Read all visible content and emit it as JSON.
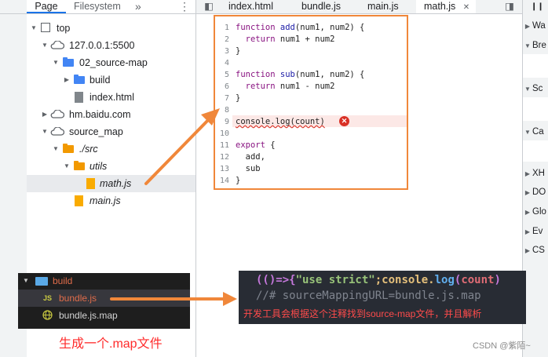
{
  "left_panel": {
    "tabs": [
      "Page",
      "Filesystem"
    ],
    "more_label": "»",
    "kebab_label": "⋮",
    "tree": [
      {
        "label": "top"
      },
      {
        "label": "127.0.0.1:5500"
      },
      {
        "label": "02_source-map"
      },
      {
        "label": "build"
      },
      {
        "label": "index.html"
      },
      {
        "label": "hm.baidu.com"
      },
      {
        "label": "source_map"
      },
      {
        "label": "./src"
      },
      {
        "label": "utils"
      },
      {
        "label": "math.js"
      },
      {
        "label": "main.js"
      }
    ]
  },
  "editor": {
    "tabs": [
      "index.html",
      "bundle.js",
      "main.js",
      "math.js"
    ],
    "close_label": "✕",
    "line_numbers": [
      "1",
      "2",
      "3",
      "4",
      "5",
      "6",
      "7",
      "8",
      "9",
      "10",
      "11",
      "12",
      "13",
      "14"
    ],
    "code": {
      "l1a": "function",
      "l1b": " add",
      "l1c": "(num1, num2) {",
      "l2a": "  return",
      "l2b": " num1 + num2",
      "l3": "}",
      "l5a": "function",
      "l5b": " sub",
      "l5c": "(num1, num2) {",
      "l6a": "  return",
      "l6b": " num1 - num2",
      "l7": "}",
      "l9": "console.log(count)",
      "l11a": "export",
      "l11b": " {",
      "l12": "  add,",
      "l13": "  sub",
      "l14": "}"
    },
    "error_glyph": "✕"
  },
  "right_panel": {
    "sections": [
      "Wa",
      "Bre",
      "Sc",
      "Ca",
      "XH",
      "DO",
      "Glo",
      "Ev",
      "CS"
    ],
    "pause_icon": "❙❙"
  },
  "vscode_snippet": {
    "folder": "build",
    "file1": "bundle.js",
    "file1_badge": "JS",
    "file2": "bundle.js.map"
  },
  "comment_snippet": {
    "line1_a": "(()=>{",
    "line1_b": "\"use strict\"",
    "line1_c": ";console.",
    "line1_d": "log",
    "line1_e": "(",
    "line1_f": "count",
    "line1_g": ")",
    "line2": "//# sourceMappingURL=bundle.js.map",
    "note": "开发工具会根据这个注释找到source-map文件，并且解析"
  },
  "caption": "生成一个.map文件",
  "watermark": "CSDN @紫陌~",
  "colors": {
    "accent": "#f0873a",
    "caption_red": "#ff2a2a"
  }
}
